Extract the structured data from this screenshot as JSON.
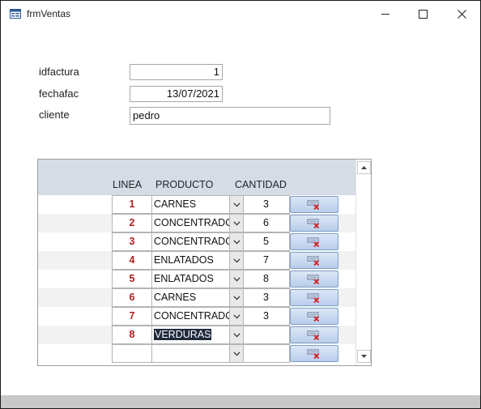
{
  "window": {
    "title": "frmVentas",
    "icon": "form-icon"
  },
  "form": {
    "idfactura_label": "idfactura",
    "idfactura_value": "1",
    "fechafac_label": "fechafac",
    "fechafac_value": "13/07/2021",
    "cliente_label": "cliente",
    "cliente_value": "pedro"
  },
  "subform": {
    "columns": {
      "linea": "LINEA",
      "producto": "PRODUCTO",
      "cantidad": "CANTIDAD"
    },
    "rows": [
      {
        "linea": "1",
        "producto": "CARNES",
        "cantidad": "3"
      },
      {
        "linea": "2",
        "producto": "CONCENTRADOS",
        "cantidad": "6"
      },
      {
        "linea": "3",
        "producto": "CONCENTRADOS",
        "cantidad": "5"
      },
      {
        "linea": "4",
        "producto": "ENLATADOS",
        "cantidad": "7"
      },
      {
        "linea": "5",
        "producto": "ENLATADOS",
        "cantidad": "8"
      },
      {
        "linea": "6",
        "producto": "CARNES",
        "cantidad": "3"
      },
      {
        "linea": "7",
        "producto": "CONCENTRADOS",
        "cantidad": "3"
      },
      {
        "linea": "8",
        "producto": "VERDURAS",
        "cantidad": ""
      },
      {
        "linea": "",
        "producto": "",
        "cantidad": ""
      }
    ],
    "selected_row": 7,
    "delete_icon": "delete-record-icon"
  },
  "colors": {
    "header_bg": "#d6dce6",
    "linea_text": "#b01e1e",
    "selection_bg": "#1f2a3c",
    "delete_icon_red": "#d42020"
  }
}
